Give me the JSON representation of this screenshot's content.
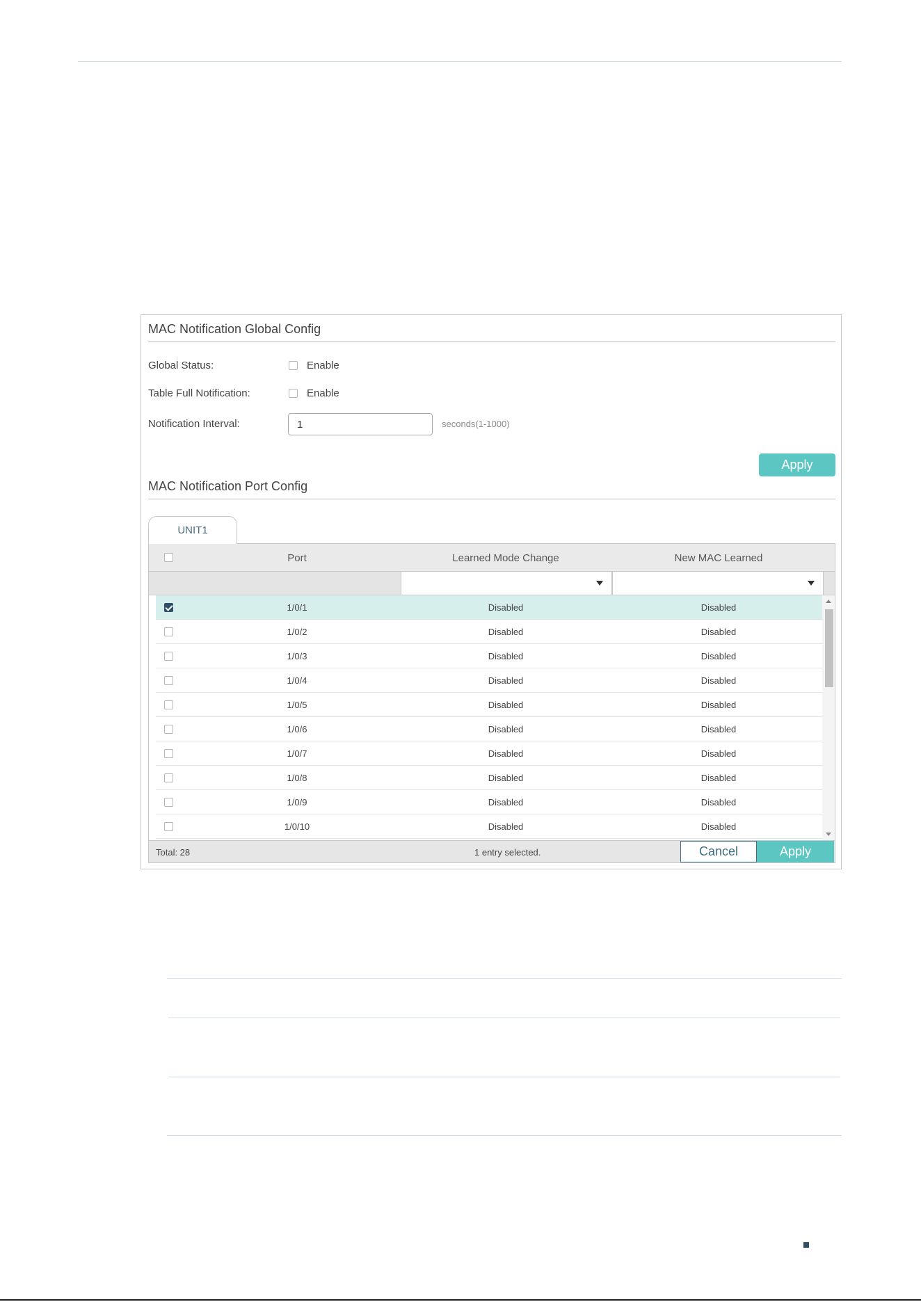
{
  "global_config": {
    "title": "MAC Notification Global Config",
    "global_status_label": "Global Status:",
    "global_status_enable": "Enable",
    "global_status_checked": false,
    "table_full_label": "Table Full Notification:",
    "table_full_enable": "Enable",
    "table_full_checked": false,
    "interval_label": "Notification Interval:",
    "interval_value": "1",
    "interval_hint": "seconds(1-1000)",
    "apply_label": "Apply"
  },
  "port_config": {
    "title": "MAC Notification Port Config",
    "tab_label": "UNIT1",
    "columns": [
      "Port",
      "Learned Mode Change",
      "New MAC Learned"
    ],
    "rows": [
      {
        "port": "1/0/1",
        "learned_mode_change": "Disabled",
        "new_mac_learned": "Disabled",
        "selected": true
      },
      {
        "port": "1/0/2",
        "learned_mode_change": "Disabled",
        "new_mac_learned": "Disabled",
        "selected": false
      },
      {
        "port": "1/0/3",
        "learned_mode_change": "Disabled",
        "new_mac_learned": "Disabled",
        "selected": false
      },
      {
        "port": "1/0/4",
        "learned_mode_change": "Disabled",
        "new_mac_learned": "Disabled",
        "selected": false
      },
      {
        "port": "1/0/5",
        "learned_mode_change": "Disabled",
        "new_mac_learned": "Disabled",
        "selected": false
      },
      {
        "port": "1/0/6",
        "learned_mode_change": "Disabled",
        "new_mac_learned": "Disabled",
        "selected": false
      },
      {
        "port": "1/0/7",
        "learned_mode_change": "Disabled",
        "new_mac_learned": "Disabled",
        "selected": false
      },
      {
        "port": "1/0/8",
        "learned_mode_change": "Disabled",
        "new_mac_learned": "Disabled",
        "selected": false
      },
      {
        "port": "1/0/9",
        "learned_mode_change": "Disabled",
        "new_mac_learned": "Disabled",
        "selected": false
      },
      {
        "port": "1/0/10",
        "learned_mode_change": "Disabled",
        "new_mac_learned": "Disabled",
        "selected": false
      }
    ],
    "total_label": "Total: 28",
    "selected_label": "1 entry selected.",
    "cancel_label": "Cancel",
    "apply_label": "Apply"
  },
  "colors": {
    "accent": "#5bc6c2",
    "selected_row": "#d7efec",
    "checkbox_checked": "#2e4f64"
  }
}
